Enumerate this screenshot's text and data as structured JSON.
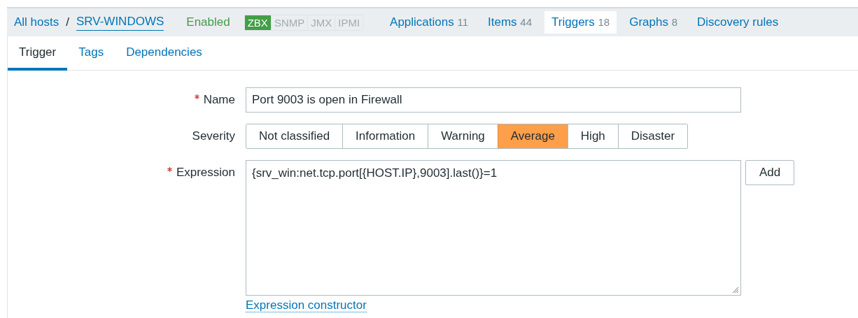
{
  "breadcrumb": {
    "root": "All hosts",
    "separator": "/",
    "host": "SRV-WINDOWS"
  },
  "status": "Enabled",
  "availability": [
    {
      "label": "ZBX",
      "on": true
    },
    {
      "label": "SNMP",
      "on": false
    },
    {
      "label": "JMX",
      "on": false
    },
    {
      "label": "IPMI",
      "on": false
    }
  ],
  "host_tabs": [
    {
      "label": "Applications",
      "count": "11",
      "selected": false
    },
    {
      "label": "Items",
      "count": "44",
      "selected": false
    },
    {
      "label": "Triggers",
      "count": "18",
      "selected": true
    },
    {
      "label": "Graphs",
      "count": "8",
      "selected": false
    },
    {
      "label": "Discovery rules",
      "selected": false
    }
  ],
  "tabs": [
    {
      "label": "Trigger",
      "selected": true
    },
    {
      "label": "Tags",
      "selected": false
    },
    {
      "label": "Dependencies",
      "selected": false
    }
  ],
  "form": {
    "name": {
      "label": "Name",
      "required": true,
      "value": "Port 9003 is open in Firewall"
    },
    "severity": {
      "label": "Severity",
      "options": [
        {
          "label": "Not classified",
          "selected": false
        },
        {
          "label": "Information",
          "selected": false
        },
        {
          "label": "Warning",
          "selected": false
        },
        {
          "label": "Average",
          "selected": true
        },
        {
          "label": "High",
          "selected": false
        },
        {
          "label": "Disaster",
          "selected": false
        }
      ]
    },
    "expression": {
      "label": "Expression",
      "required": true,
      "value": "{srv_win:net.tcp.port[{HOST.IP},9003].last()}=1",
      "add_button": "Add",
      "constructor_link": "Expression constructor"
    }
  }
}
